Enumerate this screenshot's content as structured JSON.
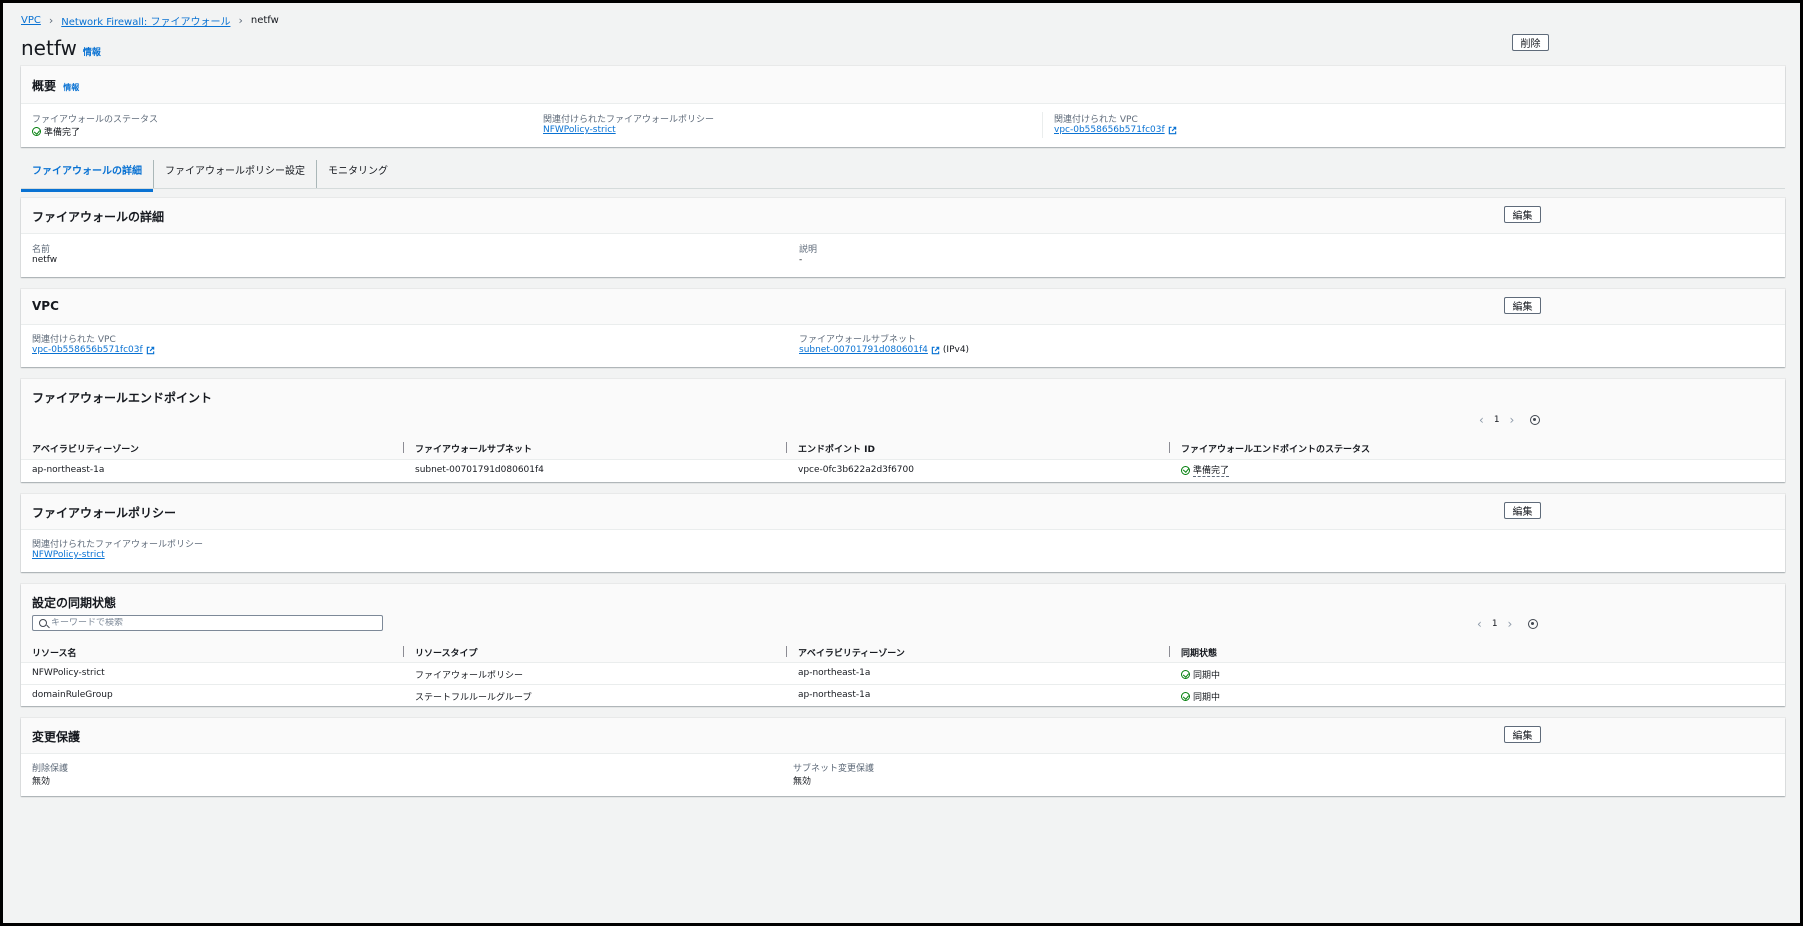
{
  "breadcrumb": {
    "vpc": "VPC",
    "nfw": "Network Firewall: ファイアウォール",
    "current": "netfw"
  },
  "page": {
    "title": "netfw",
    "info": "情報",
    "delete_label": "削除"
  },
  "overview": {
    "title": "概要",
    "info": "情報",
    "status_label": "ファイアウォールのステータス",
    "status_value": "準備完了",
    "policy_label": "関連付けられたファイアウォールポリシー",
    "policy_value": "NFWPolicy-strict",
    "vpc_label": "関連付けられた VPC",
    "vpc_value": "vpc-0b558656b571fc03f"
  },
  "tabs": [
    "ファイアウォールの詳細",
    "ファイアウォールポリシー設定",
    "モニタリング"
  ],
  "details": {
    "title": "ファイアウォールの詳細",
    "edit": "編集",
    "name_label": "名前",
    "name_value": "netfw",
    "desc_label": "説明",
    "desc_value": "-"
  },
  "vpc": {
    "title": "VPC",
    "edit": "編集",
    "vpc_label": "関連付けられた VPC",
    "vpc_value": "vpc-0b558656b571fc03f",
    "subnet_label": "ファイアウォールサブネット",
    "subnet_value": "subnet-00701791d080601f4",
    "subnet_suffix": "(IPv4)"
  },
  "endpoints": {
    "title": "ファイアウォールエンドポイント",
    "page": "1",
    "headers": [
      "アベイラビリティーゾーン",
      "ファイアウォールサブネット",
      "エンドポイント ID",
      "ファイアウォールエンドポイントのステータス"
    ],
    "rows": [
      {
        "az": "ap-northeast-1a",
        "subnet": "subnet-00701791d080601f4",
        "endpoint": "vpce-0fc3b622a2d3f6700",
        "status": "準備完了"
      }
    ]
  },
  "policy": {
    "title": "ファイアウォールポリシー",
    "edit": "編集",
    "label": "関連付けられたファイアウォールポリシー",
    "value": "NFWPolicy-strict"
  },
  "sync": {
    "title": "設定の同期状態",
    "search_placeholder": "キーワードで検索",
    "page": "1",
    "headers": [
      "リソース名",
      "リソースタイプ",
      "アベイラビリティーゾーン",
      "同期状態"
    ],
    "rows": [
      {
        "name": "NFWPolicy-strict",
        "type": "ファイアウォールポリシー",
        "az": "ap-northeast-1a",
        "status": "同期中"
      },
      {
        "name": "domainRuleGroup",
        "type": "ステートフルルールグループ",
        "az": "ap-northeast-1a",
        "status": "同期中"
      }
    ]
  },
  "protection": {
    "title": "変更保護",
    "edit": "編集",
    "delete_label": "削除保護",
    "delete_value": "無効",
    "subnet_label": "サブネット変更保護",
    "subnet_value": "無効"
  },
  "colors": {
    "link": "#0972d3",
    "success": "#037f0c",
    "background": "#f2f3f3"
  }
}
